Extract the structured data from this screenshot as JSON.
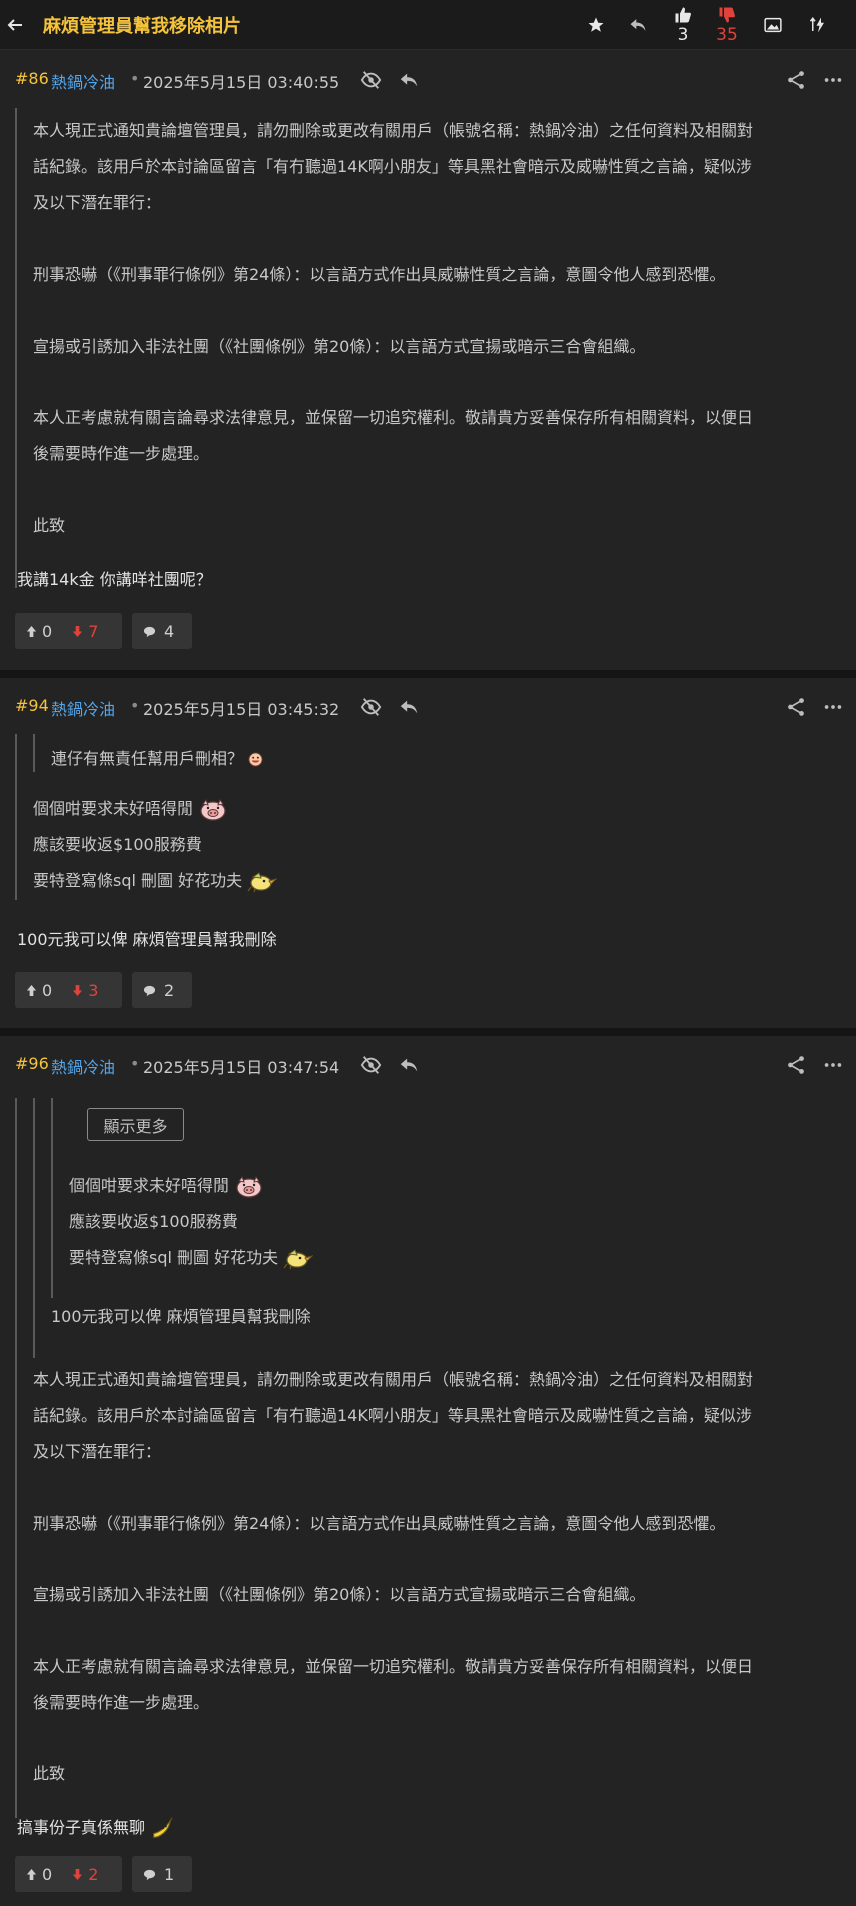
{
  "header": {
    "title": "麻煩管理員幫我移除相片",
    "upvotes": "3",
    "downvotes": "35",
    "colors": {
      "accent": "#f5c33b",
      "user": "#55a6ea",
      "downvote": "#e0433b",
      "background": "#232323"
    }
  },
  "posts": [
    {
      "number": "#86",
      "username": "熱鍋冷油",
      "dot": "•",
      "timestamp": "2025年5月15日 03:40:55",
      "quote": [
        "本人現正式通知貴論壇管理員，請勿刪除或更改有關用戶（帳號名稱：熱鍋冷油）之任何資料及相關對",
        "話紀錄。該用戶於本討論區留言「有冇聽過14K啊小朋友」等具黑社會暗示及威嚇性質之言論，疑似涉",
        "及以下潛在罪行：",
        "刑事恐嚇（《刑事罪行條例》第24條）：以言語方式作出具威嚇性質之言論，意圖令他人感到恐懼。",
        "宣揚或引誘加入非法社團（《社團條例》第20條）：以言語方式宣揚或暗示三合會組織。",
        "本人正考慮就有關言論尋求法律意見，並保留一切追究權利。敬請貴方妥善保存所有相關資料，以便日",
        "後需要時作進一步處理。",
        "此致"
      ],
      "body": "我講14k金 你講咩社團呢？",
      "up": "0",
      "down": "7",
      "comments": "4"
    },
    {
      "number": "#94",
      "username": "熱鍋冷油",
      "dot": "•",
      "timestamp": "2025年5月15日 03:45:32",
      "inner_quote": "連仔有無責任幫用戶刪相？",
      "quote": [
        "個個咁要求未好唔得閒",
        "應該要收返$100服務費",
        "要特登寫條sql 刪圖 好花功夫"
      ],
      "body": "100元我可以俾 麻煩管理員幫我刪除",
      "up": "0",
      "down": "3",
      "comments": "2"
    },
    {
      "number": "#96",
      "username": "熱鍋冷油",
      "dot": "•",
      "timestamp": "2025年5月15日 03:47:54",
      "show_more": "顯示更多",
      "inner_quote": [
        "個個咁要求未好唔得閒",
        "應該要收返$100服務費",
        "要特登寫條sql 刪圖 好花功夫"
      ],
      "mid_quote": "100元我可以俾 麻煩管理員幫我刪除",
      "quote": [
        "本人現正式通知貴論壇管理員，請勿刪除或更改有關用戶（帳號名稱：熱鍋冷油）之任何資料及相關對",
        "話紀錄。該用戶於本討論區留言「有冇聽過14K啊小朋友」等具黑社會暗示及威嚇性質之言論，疑似涉",
        "及以下潛在罪行：",
        "刑事恐嚇（《刑事罪行條例》第24條）：以言語方式作出具威嚇性質之言論，意圖令他人感到恐懼。",
        "宣揚或引誘加入非法社團（《社團條例》第20條）：以言語方式宣揚或暗示三合會組織。",
        "本人正考慮就有關言論尋求法律意見，並保留一切追究權利。敬請貴方妥善保存所有相關資料，以便日",
        "後需要時作進一步處理。",
        "此致"
      ],
      "body": "搞事份子真係無聊",
      "up": "0",
      "down": "2",
      "comments": "1"
    }
  ]
}
